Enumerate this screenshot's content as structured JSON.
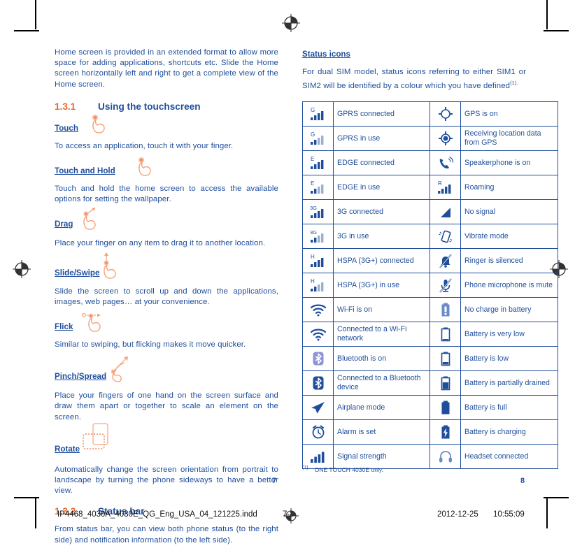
{
  "document": {
    "left_page_number": "7",
    "right_page_number": "8",
    "slug_filename": "IP4468_4030A_4030E_QG_Eng_USA_04_121225.indd",
    "slug_pages": "7-8",
    "slug_date": "2012-12-25",
    "slug_time": "10:55:09"
  },
  "colors": {
    "text_blue": "#1F4E9C",
    "accent_orange": "#E8682C",
    "icon_light": "#F8A882",
    "bluetooth_light": "#8C93D6"
  },
  "left_page": {
    "intro": "Home screen is provided in an extended format to allow more space for adding applications, shortcuts etc. Slide the Home screen horizontally left and right to get a complete view of the Home screen.",
    "section_1": {
      "number": "1.3.1",
      "title": "Using the touchscreen"
    },
    "gestures": [
      {
        "label": "Touch",
        "icon": "touch-hand-icon",
        "text": "To access an application, touch it with your finger."
      },
      {
        "label": "Touch and Hold",
        "icon": "touch-hold-hand-icon",
        "text": "Touch and hold the home screen to access the available options for setting the wallpaper."
      },
      {
        "label": "Drag",
        "icon": "drag-hand-icon",
        "text": "Place your finger on any item to drag it to another location."
      },
      {
        "label": "Slide/Swipe",
        "icon": "slide-hand-icon",
        "text": "Slide the screen to scroll up and down the applications, images, web pages… at your convenience."
      },
      {
        "label": "Flick",
        "icon": "flick-hand-icon",
        "text": "Similar to swiping, but flicking makes it move quicker."
      },
      {
        "label": "Pinch/Spread",
        "icon": "pinch-spread-hand-icon",
        "text": "Place your fingers of one hand on the screen surface and draw them apart or together to scale an element on the screen."
      },
      {
        "label": "Rotate",
        "icon": "rotate-phone-icon",
        "text": "Automatically change the screen orientation from portrait to landscape by turning the phone sideways to have a better view."
      }
    ],
    "section_2": {
      "number": "1.3.2",
      "title": "Status bar"
    },
    "status_bar_text": "From status bar, you can view both phone status (to the right side) and notification information (to the left side)."
  },
  "right_page": {
    "heading": "Status icons",
    "intro": "For dual SIM model, status icons referring to either SIM1 or SIM2 will be identified by a colour which you have defined",
    "intro_footnote_mark": "(1).",
    "table_rows": [
      {
        "icon_left": "gprs-connected-icon",
        "label_left": "GPRS connected",
        "icon_right": "gps-on-icon",
        "label_right": "GPS is on"
      },
      {
        "icon_left": "gprs-in-use-icon",
        "label_left": "GPRS in use",
        "icon_right": "gps-receiving-icon",
        "label_right": "Receiving location data from GPS"
      },
      {
        "icon_left": "edge-connected-icon",
        "label_left": "EDGE connected",
        "icon_right": "speakerphone-icon",
        "label_right": "Speakerphone is on"
      },
      {
        "icon_left": "edge-in-use-icon",
        "label_left": "EDGE in use",
        "icon_right": "roaming-icon",
        "label_right": "Roaming"
      },
      {
        "icon_left": "3g-connected-icon",
        "label_left": "3G connected",
        "icon_right": "no-signal-icon",
        "label_right": "No signal"
      },
      {
        "icon_left": "3g-in-use-icon",
        "label_left": "3G in use",
        "icon_right": "vibrate-mode-icon",
        "label_right": "Vibrate mode"
      },
      {
        "icon_left": "hspa-connected-icon",
        "label_left": "HSPA (3G+) connected",
        "icon_right": "ringer-silenced-icon",
        "label_right": "Ringer is silenced"
      },
      {
        "icon_left": "hspa-in-use-icon",
        "label_left": "HSPA (3G+) in use",
        "icon_right": "microphone-mute-icon",
        "label_right": "Phone microphone is mute"
      },
      {
        "icon_left": "wifi-on-icon",
        "label_left": "Wi-Fi is on",
        "icon_right": "battery-empty-icon",
        "label_right": "No charge in battery"
      },
      {
        "icon_left": "wifi-connected-icon",
        "label_left": "Connected to a Wi-Fi network",
        "icon_right": "battery-very-low-icon",
        "label_right": "Battery is very low"
      },
      {
        "icon_left": "bluetooth-on-icon",
        "label_left": "Bluetooth is on",
        "icon_right": "battery-low-icon",
        "label_right": "Battery is low"
      },
      {
        "icon_left": "bluetooth-connected-icon",
        "label_left": "Connected to a Bluetooth device",
        "icon_right": "battery-partial-icon",
        "label_right": "Battery is partially drained"
      },
      {
        "icon_left": "airplane-mode-icon",
        "label_left": "Airplane mode",
        "icon_right": "battery-full-icon",
        "label_right": "Battery is full"
      },
      {
        "icon_left": "alarm-set-icon",
        "label_left": "Alarm is set",
        "icon_right": "battery-charging-icon",
        "label_right": "Battery is charging"
      },
      {
        "icon_left": "signal-strength-icon",
        "label_left": "Signal strength",
        "icon_right": "headset-connected-icon",
        "label_right": "Headset connected"
      }
    ],
    "footnote_mark": "(1)",
    "footnote_text": "ONE TOUCH 4030E only."
  }
}
